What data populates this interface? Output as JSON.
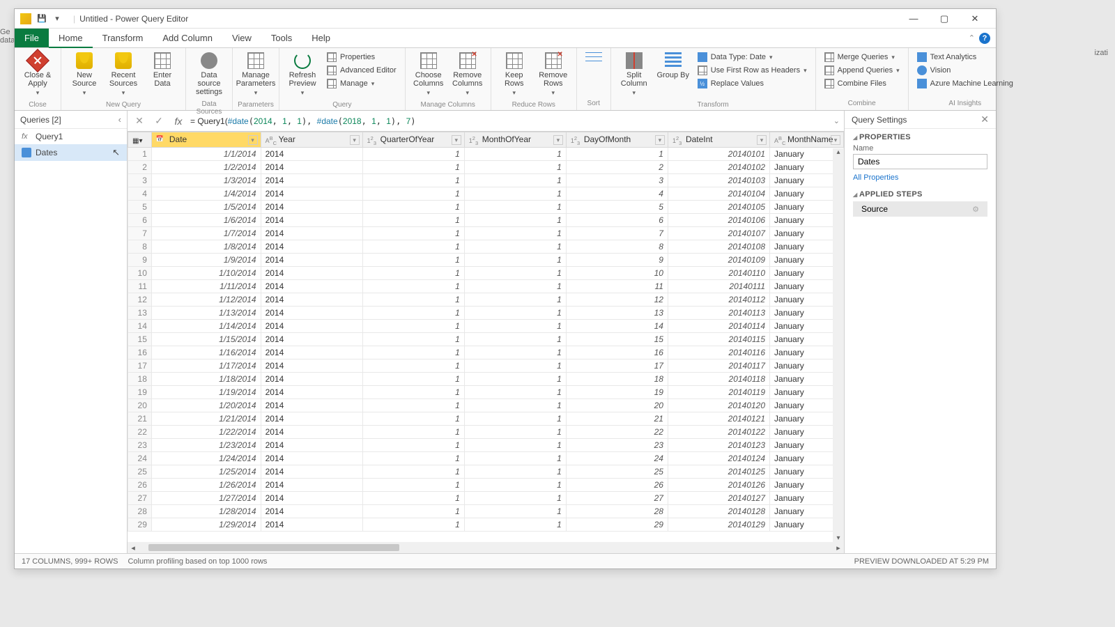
{
  "title": "Untitled - Power Query Editor",
  "menus": {
    "file": "File",
    "home": "Home",
    "transform": "Transform",
    "addcol": "Add Column",
    "view": "View",
    "tools": "Tools",
    "help": "Help"
  },
  "ribbon": {
    "close_apply": "Close &\nApply",
    "new_source": "New\nSource",
    "recent_sources": "Recent\nSources",
    "enter_data": "Enter\nData",
    "ds_settings": "Data source\nsettings",
    "manage_params": "Manage\nParameters",
    "refresh_preview": "Refresh\nPreview",
    "properties": "Properties",
    "adv_editor": "Advanced Editor",
    "manage": "Manage",
    "choose_cols": "Choose\nColumns",
    "remove_cols": "Remove\nColumns",
    "keep_rows": "Keep\nRows",
    "remove_rows": "Remove\nRows",
    "sort": "Sort",
    "split_col": "Split\nColumn",
    "group_by": "Group\nBy",
    "data_type": "Data Type: Date",
    "first_row": "Use First Row as Headers",
    "replace_vals": "Replace Values",
    "merge_q": "Merge Queries",
    "append_q": "Append Queries",
    "combine_files": "Combine Files",
    "text_analytics": "Text Analytics",
    "vision": "Vision",
    "azure_ml": "Azure Machine Learning",
    "grp_close": "Close",
    "grp_newq": "New Query",
    "grp_ds": "Data Sources",
    "grp_params": "Parameters",
    "grp_query": "Query",
    "grp_mcols": "Manage Columns",
    "grp_rrows": "Reduce Rows",
    "grp_sort": "Sort",
    "grp_transform": "Transform",
    "grp_combine": "Combine",
    "grp_ai": "AI Insights"
  },
  "queries": {
    "title": "Queries [2]",
    "items": [
      "Query1",
      "Dates"
    ]
  },
  "formula": "= Query1(#date(2014, 1, 1), #date(2018, 1, 1), 7)",
  "columns": [
    {
      "name": "Date",
      "type": "date",
      "sel": true
    },
    {
      "name": "Year",
      "type": "abc"
    },
    {
      "name": "QuarterOfYear",
      "type": "123"
    },
    {
      "name": "MonthOfYear",
      "type": "123"
    },
    {
      "name": "DayOfMonth",
      "type": "123"
    },
    {
      "name": "DateInt",
      "type": "123"
    },
    {
      "name": "MonthName",
      "type": "abc"
    }
  ],
  "rows": [
    [
      "1/1/2014",
      "2014",
      "1",
      "1",
      "1",
      "20140101",
      "January"
    ],
    [
      "1/2/2014",
      "2014",
      "1",
      "1",
      "2",
      "20140102",
      "January"
    ],
    [
      "1/3/2014",
      "2014",
      "1",
      "1",
      "3",
      "20140103",
      "January"
    ],
    [
      "1/4/2014",
      "2014",
      "1",
      "1",
      "4",
      "20140104",
      "January"
    ],
    [
      "1/5/2014",
      "2014",
      "1",
      "1",
      "5",
      "20140105",
      "January"
    ],
    [
      "1/6/2014",
      "2014",
      "1",
      "1",
      "6",
      "20140106",
      "January"
    ],
    [
      "1/7/2014",
      "2014",
      "1",
      "1",
      "7",
      "20140107",
      "January"
    ],
    [
      "1/8/2014",
      "2014",
      "1",
      "1",
      "8",
      "20140108",
      "January"
    ],
    [
      "1/9/2014",
      "2014",
      "1",
      "1",
      "9",
      "20140109",
      "January"
    ],
    [
      "1/10/2014",
      "2014",
      "1",
      "1",
      "10",
      "20140110",
      "January"
    ],
    [
      "1/11/2014",
      "2014",
      "1",
      "1",
      "11",
      "20140111",
      "January"
    ],
    [
      "1/12/2014",
      "2014",
      "1",
      "1",
      "12",
      "20140112",
      "January"
    ],
    [
      "1/13/2014",
      "2014",
      "1",
      "1",
      "13",
      "20140113",
      "January"
    ],
    [
      "1/14/2014",
      "2014",
      "1",
      "1",
      "14",
      "20140114",
      "January"
    ],
    [
      "1/15/2014",
      "2014",
      "1",
      "1",
      "15",
      "20140115",
      "January"
    ],
    [
      "1/16/2014",
      "2014",
      "1",
      "1",
      "16",
      "20140116",
      "January"
    ],
    [
      "1/17/2014",
      "2014",
      "1",
      "1",
      "17",
      "20140117",
      "January"
    ],
    [
      "1/18/2014",
      "2014",
      "1",
      "1",
      "18",
      "20140118",
      "January"
    ],
    [
      "1/19/2014",
      "2014",
      "1",
      "1",
      "19",
      "20140119",
      "January"
    ],
    [
      "1/20/2014",
      "2014",
      "1",
      "1",
      "20",
      "20140120",
      "January"
    ],
    [
      "1/21/2014",
      "2014",
      "1",
      "1",
      "21",
      "20140121",
      "January"
    ],
    [
      "1/22/2014",
      "2014",
      "1",
      "1",
      "22",
      "20140122",
      "January"
    ],
    [
      "1/23/2014",
      "2014",
      "1",
      "1",
      "23",
      "20140123",
      "January"
    ],
    [
      "1/24/2014",
      "2014",
      "1",
      "1",
      "24",
      "20140124",
      "January"
    ],
    [
      "1/25/2014",
      "2014",
      "1",
      "1",
      "25",
      "20140125",
      "January"
    ],
    [
      "1/26/2014",
      "2014",
      "1",
      "1",
      "26",
      "20140126",
      "January"
    ],
    [
      "1/27/2014",
      "2014",
      "1",
      "1",
      "27",
      "20140127",
      "January"
    ],
    [
      "1/28/2014",
      "2014",
      "1",
      "1",
      "28",
      "20140128",
      "January"
    ],
    [
      "1/29/2014",
      "2014",
      "1",
      "1",
      "29",
      "20140129",
      "January"
    ]
  ],
  "settings": {
    "title": "Query Settings",
    "properties": "PROPERTIES",
    "name_label": "Name",
    "name_value": "Dates",
    "all_props": "All Properties",
    "applied_steps": "APPLIED STEPS",
    "steps": [
      "Source"
    ]
  },
  "status": {
    "left1": "17 COLUMNS, 999+ ROWS",
    "left2": "Column profiling based on top 1000 rows",
    "right": "PREVIEW DOWNLOADED AT 5:29 PM"
  }
}
